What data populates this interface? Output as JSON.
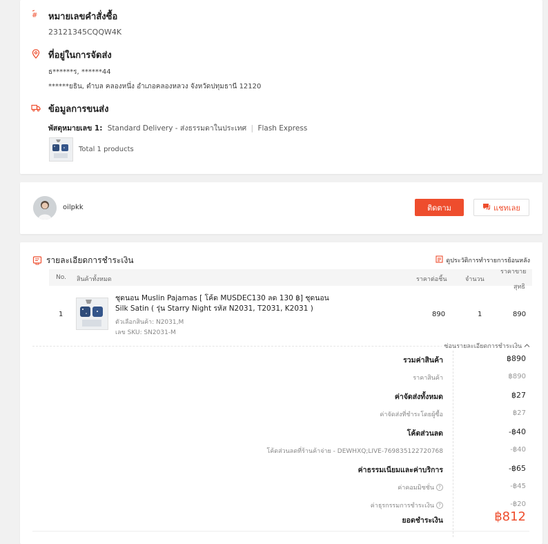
{
  "order": {
    "title": "หมายเลขคำสั่งซื้อ",
    "number": "23121345CQQW4K"
  },
  "address": {
    "title": "ที่อยู่ในการจัดส่ง",
    "name_phone": "ธ******ร, ******44",
    "line": "******ยธิน, ตำบล คลองหนึ่ง อำเภอคลองหลวง จังหวัดปทุมธานี 12120"
  },
  "shipping": {
    "title": "ข้อมูลการขนส่ง",
    "parcel_label": "พัสดุหมายเลข 1:",
    "method": "Standard Delivery - ส่งธรรมดาในประเทศ",
    "separator": "|",
    "carrier": "Flash Express",
    "total_products": "Total 1 products"
  },
  "shop": {
    "name": "oilpkk",
    "follow_label": "ติดตาม",
    "chat_label": "แชทเลย"
  },
  "payment": {
    "title": "รายละเอียดการชำระเงิน",
    "history_link": "ดูประวัติการทำรายการย้อนหลัง",
    "columns": {
      "no": "No.",
      "all_products": "สินค้าทั้งหมด",
      "unit_price": "ราคาต่อชิ้น",
      "qty": "จำนวน",
      "net_price_1": "ราคาขาย",
      "net_price_2": "สุทธิ"
    },
    "item": {
      "no": "1",
      "name_line1": "ชุดนอน Muslin Pajamas [ โค้ด MUSDEC130 ลด 130 ฿] ชุดนอน",
      "name_line2": "Silk Satin ( รุ่น Starry Night รหัส N2031, T2031, K2031 )",
      "variant": "ตัวเลือกสินค้า: N2031,M",
      "sku": "เลข SKU: SN2031-M",
      "unit_price": "890",
      "qty": "1",
      "net": "890"
    },
    "hide_details": "ซ่อนรายละเอียดการชำระเงิน",
    "summary": [
      {
        "label": "รวมค่าสินค้า",
        "value": "฿890",
        "level": "main"
      },
      {
        "label": "ราคาสินค้า",
        "value": "฿890",
        "level": "sub"
      },
      {
        "label": "ค่าจัดส่งทั้งหมด",
        "value": "฿27",
        "level": "main"
      },
      {
        "label": "ค่าจัดส่งที่ชำระโดยผู้ซื้อ",
        "value": "฿27",
        "level": "sub"
      },
      {
        "label": "โค้ดส่วนลด",
        "value": "-฿40",
        "level": "main"
      },
      {
        "label": "โค้ดส่วนลดที่ร้านค้าจ่าย - DEWHXQ;LIVE-769835122720768",
        "value": "-฿40",
        "level": "sub"
      },
      {
        "label": "ค่าธรรมเนียมและค่าบริการ",
        "value": "-฿65",
        "level": "main"
      },
      {
        "label": "ค่าคอมมิชชั่น",
        "value": "-฿45",
        "level": "sub"
      },
      {
        "label": "ค่าธุรกรรมการชำระเงิน",
        "value": "-฿20",
        "level": "sub"
      }
    ],
    "total_label": "ยอดชำระเงิน",
    "total_value": "฿812"
  },
  "colors": {
    "accent": "#ee4d2d",
    "background": "#f1f1f1"
  }
}
